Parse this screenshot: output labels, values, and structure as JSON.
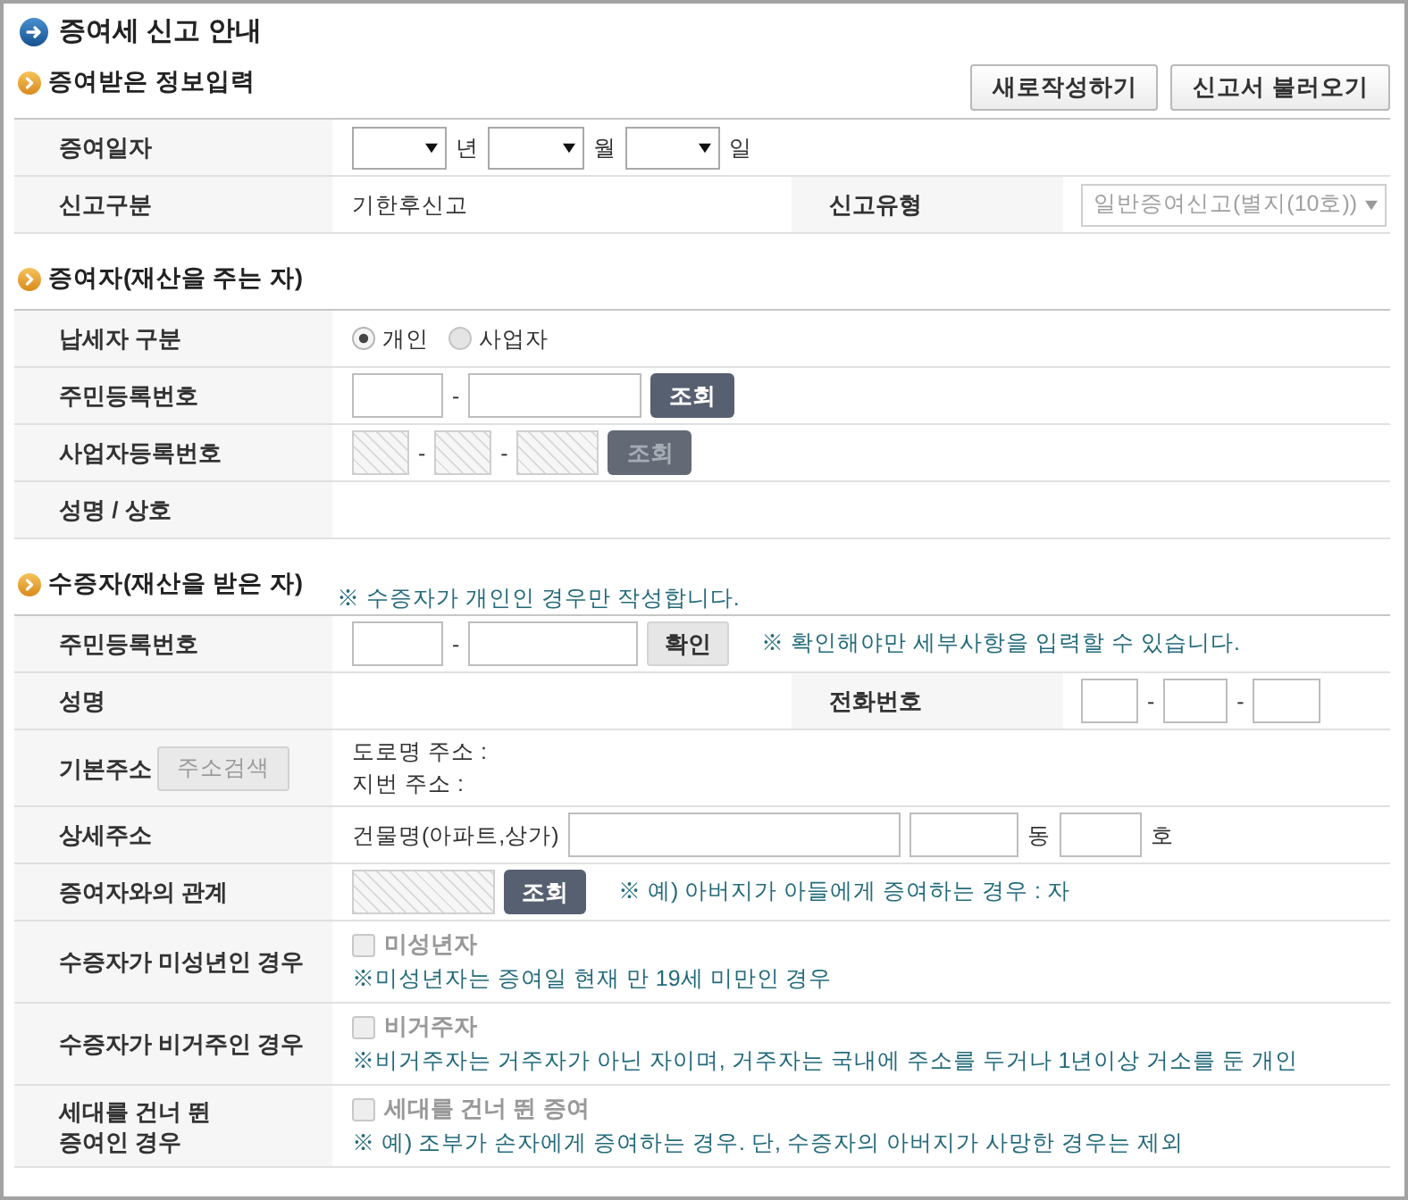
{
  "page_title": "증여세 신고 안내",
  "sections": [
    {
      "title": "증여받은 정보입력",
      "buttons": [
        "새로작성하기",
        "신고서 불러오기"
      ],
      "rows": [
        {
          "label": "증여일자",
          "lines": [
            [
              {
                "kind": "select",
                "disabled": false
              },
              {
                "kind": "text",
                "text": "년"
              },
              {
                "kind": "select",
                "disabled": false
              },
              {
                "kind": "text",
                "text": "월"
              },
              {
                "kind": "select",
                "disabled": false
              },
              {
                "kind": "text",
                "text": "일"
              }
            ]
          ]
        },
        {
          "label": "신고구분",
          "lines": [
            [
              {
                "kind": "text",
                "text": "기한후신고"
              }
            ]
          ],
          "side": {
            "label": "신고유형",
            "lines": [
              [
                {
                  "kind": "select",
                  "value": "일반증여신고(별지(10호))",
                  "disabled": true
                }
              ]
            ]
          }
        }
      ]
    },
    {
      "title": "증여자(재산을 주는 자)",
      "rows": [
        {
          "label": "납세자 구분",
          "lines": [
            [
              {
                "kind": "radio",
                "options": [
                  {
                    "label": "개인",
                    "selected": true
                  },
                  {
                    "label": "사업자",
                    "selected": false
                  }
                ]
              }
            ]
          ]
        },
        {
          "label": "주민등록번호",
          "lines": [
            [
              {
                "kind": "input",
                "disabled": false
              },
              {
                "kind": "text",
                "text": "-"
              },
              {
                "kind": "input",
                "disabled": false
              },
              {
                "kind": "button_dark",
                "label": "조회",
                "disabled": false
              }
            ]
          ]
        },
        {
          "label": "사업자등록번호",
          "lines": [
            [
              {
                "kind": "input",
                "disabled": true
              },
              {
                "kind": "text",
                "text": "-"
              },
              {
                "kind": "input",
                "disabled": true
              },
              {
                "kind": "text",
                "text": "-"
              },
              {
                "kind": "input",
                "disabled": true
              },
              {
                "kind": "button_dark",
                "label": "조회",
                "disabled": true
              }
            ]
          ]
        },
        {
          "label": "성명 / 상호"
        }
      ]
    },
    {
      "title": "수증자(재산을 받은 자)",
      "note": "※ 수증자가 개인인 경우만 작성합니다.",
      "rows": [
        {
          "label": "주민등록번호",
          "lines": [
            [
              {
                "kind": "input",
                "disabled": false
              },
              {
                "kind": "text",
                "text": "-"
              },
              {
                "kind": "input",
                "disabled": false
              },
              {
                "kind": "button_light",
                "label": "확인",
                "disabled": false
              },
              {
                "kind": "note",
                "text": "※ 확인해야만 세부사항을 입력할 수 있습니다."
              }
            ]
          ]
        },
        {
          "label": "성명",
          "side": {
            "label": "전화번호",
            "lines": [
              [
                {
                  "kind": "input",
                  "disabled": false
                },
                {
                  "kind": "text",
                  "text": "-"
                },
                {
                  "kind": "input",
                  "disabled": false
                },
                {
                  "kind": "text",
                  "text": "-"
                },
                {
                  "kind": "input",
                  "disabled": false
                }
              ]
            ]
          }
        },
        {
          "label": "기본주소",
          "label_button": {
            "label": "주소검색",
            "disabled": true
          },
          "lines": [
            [
              {
                "kind": "text",
                "text": "도로명 주소 :"
              }
            ],
            [
              {
                "kind": "text",
                "text": "지번 주소 :"
              }
            ]
          ]
        },
        {
          "label": "상세주소",
          "lines": [
            [
              {
                "kind": "text",
                "text": "건물명(아파트,상가)"
              },
              {
                "kind": "input",
                "disabled": false
              },
              {
                "kind": "input",
                "disabled": false
              },
              {
                "kind": "text",
                "text": "동"
              },
              {
                "kind": "input",
                "disabled": false
              },
              {
                "kind": "text",
                "text": "호"
              }
            ]
          ]
        },
        {
          "label": "증여자와의 관계",
          "lines": [
            [
              {
                "kind": "input",
                "disabled": true
              },
              {
                "kind": "button_dark",
                "label": "조회",
                "disabled": false
              },
              {
                "kind": "note",
                "text": "※ 예) 아버지가 아들에게 증여하는 경우 : 자"
              }
            ]
          ]
        },
        {
          "label": "수증자가 미성년인 경우",
          "lines": [
            [
              {
                "kind": "checkbox",
                "label": "미성년자",
                "checked": false,
                "disabled": true
              }
            ],
            [
              {
                "kind": "note",
                "text": "※미성년자는 증여일 현재 만 19세 미만인 경우"
              }
            ]
          ]
        },
        {
          "label": "수증자가 비거주인 경우",
          "lines": [
            [
              {
                "kind": "checkbox",
                "label": "비거주자",
                "checked": false,
                "disabled": true
              }
            ],
            [
              {
                "kind": "note",
                "text": "※비거주자는 거주자가 아닌 자이며, 거주자는 국내에 주소를 두거나 1년이상 거소를 둔 개인"
              }
            ]
          ]
        },
        {
          "label": "세대를 건너 뛴\n증여인 경우",
          "lines": [
            [
              {
                "kind": "checkbox",
                "label": "세대를 건너 뛴 증여",
                "checked": false,
                "disabled": true
              }
            ],
            [
              {
                "kind": "note",
                "text": "※ 예) 조부가 손자에게 증여하는 경우. 단, 수증자의 아버지가 사망한 경우는 제외"
              }
            ]
          ]
        }
      ]
    }
  ]
}
